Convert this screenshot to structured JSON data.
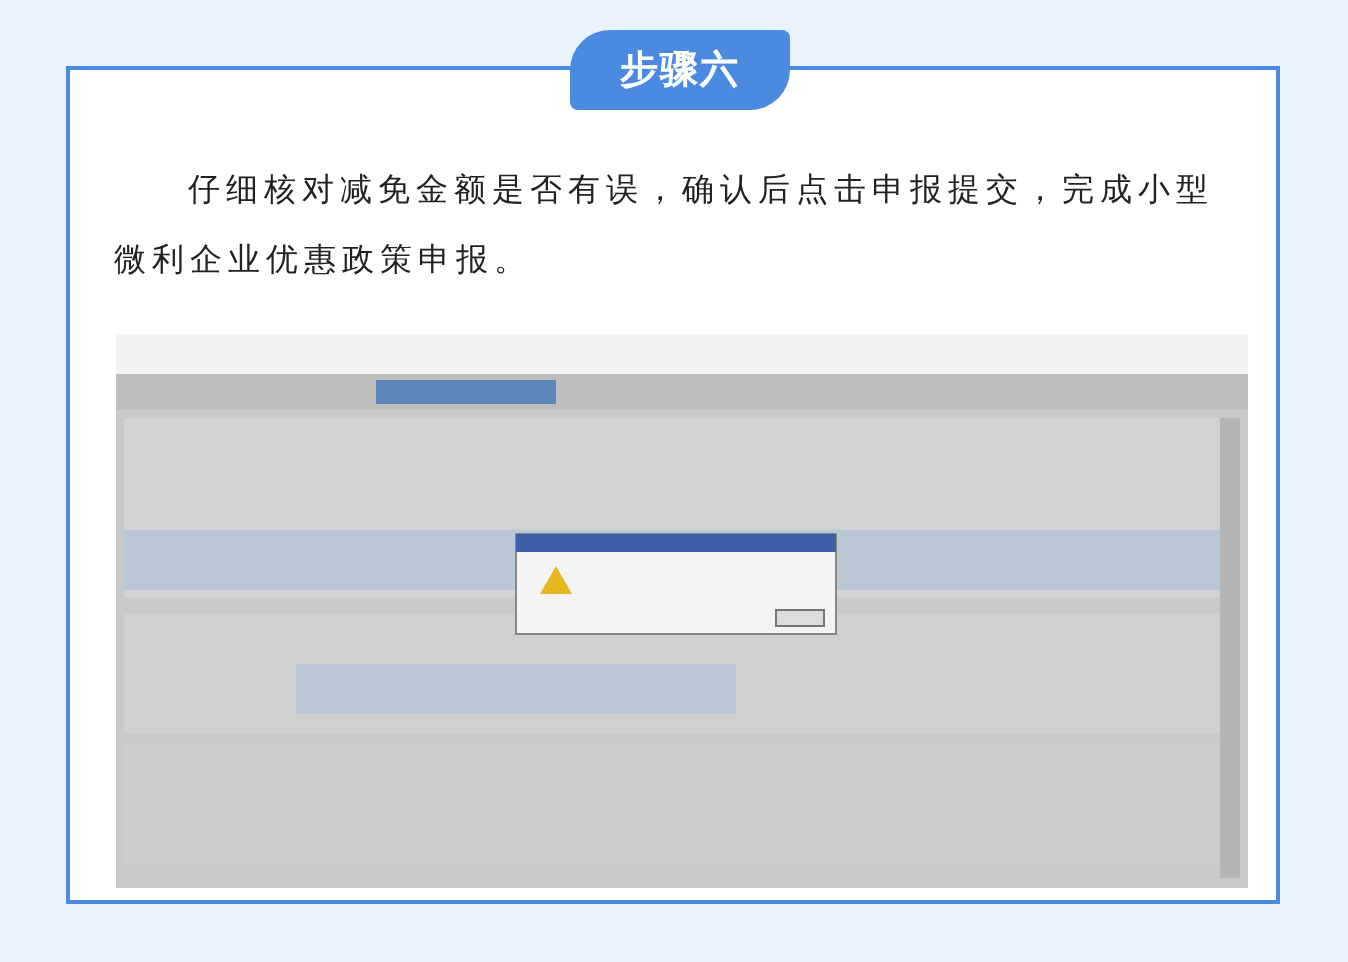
{
  "step": {
    "label": "步骤六"
  },
  "paragraph": "仔细核对减免金额是否有误，确认后点击申报提交，完成小型微利企业优惠政策申报。"
}
